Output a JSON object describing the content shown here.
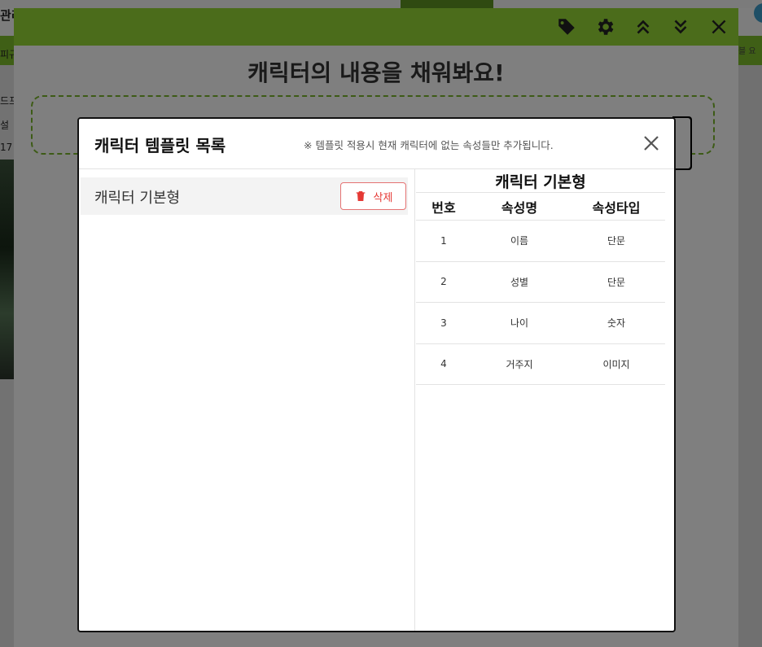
{
  "background": {
    "left_fragments": [
      "관리",
      "피규",
      "드프",
      "설",
      "17",
      ":"
    ],
    "right_fragment": "블 요"
  },
  "editor": {
    "title": "캐릭터의 내용을 채워봐요!",
    "toolbar_icons": [
      "tag-icon",
      "gear-icon",
      "chevrons-up-icon",
      "chevrons-down-icon",
      "close-icon"
    ]
  },
  "modal": {
    "title": "캐릭터 템플릿 목록",
    "notice": "※ 템플릿 적용시 현재 캐릭터에 없는 속성들만 추가됩니다.",
    "templates": [
      {
        "name": "캐릭터 기본형",
        "delete_label": "삭제"
      }
    ],
    "detail": {
      "title": "캐릭터 기본형",
      "headers": [
        "번호",
        "속성명",
        "속성타입"
      ],
      "rows": [
        [
          "1",
          "이름",
          "단문"
        ],
        [
          "2",
          "성별",
          "단문"
        ],
        [
          "3",
          "나이",
          "숫자"
        ],
        [
          "4",
          "거주지",
          "이미지"
        ]
      ]
    }
  },
  "colors": {
    "header_green": "#4b6c1b",
    "delete_red": "#e53935",
    "overlay": "#7f7f7f"
  }
}
